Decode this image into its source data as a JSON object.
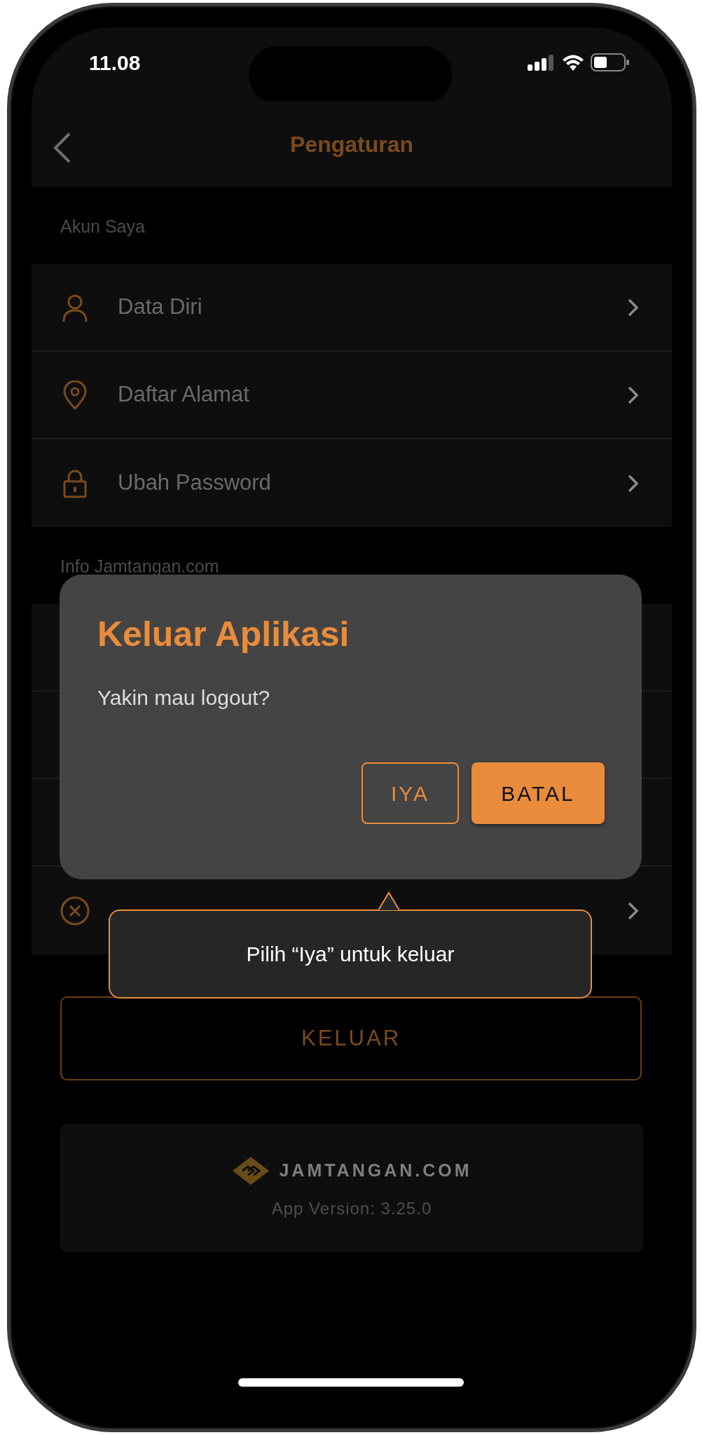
{
  "status_bar": {
    "time": "11.08"
  },
  "header": {
    "title": "Pengaturan"
  },
  "sections": [
    {
      "label": "Akun Saya",
      "items": [
        {
          "label": "Data Diri",
          "kind": "person"
        },
        {
          "label": "Daftar Alamat",
          "kind": "pin"
        },
        {
          "label": "Ubah Password",
          "kind": "lock"
        }
      ]
    },
    {
      "label": "Info Jamtangan.com",
      "items": [
        {
          "kind": "cancel"
        }
      ]
    }
  ],
  "logout_button": "KELUAR",
  "footer": {
    "brand": "JAMTANGAN.COM",
    "version": "App Version: 3.25.0"
  },
  "dialog": {
    "title": "Keluar Aplikasi",
    "message": "Yakin mau logout?",
    "buttons": [
      {
        "label": "IYA",
        "kind": "outline"
      },
      {
        "label": "BATAL",
        "kind": "filled"
      }
    ]
  },
  "tooltip": {
    "text": "Pilih “Iya” untuk keluar"
  }
}
